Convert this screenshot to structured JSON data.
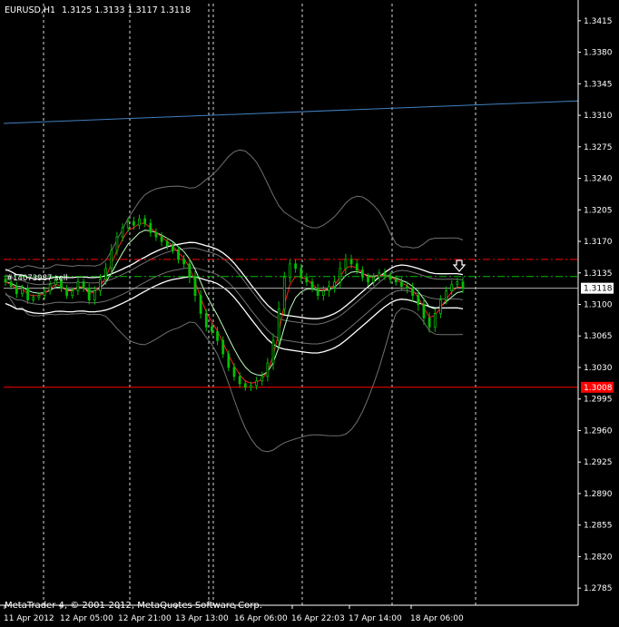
{
  "header": {
    "symbol": "EURUSD,H1",
    "ohlc": "1.3125 1.3133 1.3117 1.3118"
  },
  "order_label": "#14073987 sell",
  "footer": "MetaTrader 4, © 2001-2012, MetaQuotes Software Corp.",
  "colors": {
    "background": "#000000",
    "axis": "#ffffff",
    "candle": "#00c000",
    "fast_ma": "#ff2020",
    "slow_ma": "#c0ffc0",
    "envelope": "#ffffff",
    "bollinger": "#707070",
    "trend_line": "#4080c0",
    "order_line": "#00c000",
    "sl_line": "#ff0000",
    "support_line": "#ff0000",
    "bid_line": "#b0b0b0"
  },
  "chart_data": {
    "type": "candlestick",
    "timeframe": "H1",
    "ylim": [
      1.2766,
      1.3434
    ],
    "y_ticks": [
      "1.3415",
      "1.3380",
      "1.3345",
      "1.3310",
      "1.3275",
      "1.3240",
      "1.3205",
      "1.3170",
      "1.3135",
      "1.3100",
      "1.3065",
      "1.3030",
      "1.2995",
      "1.2960",
      "1.2925",
      "1.2890",
      "1.2855",
      "1.2820",
      "1.2785"
    ],
    "x_ticks": [
      "11 Apr 2012",
      "12 Apr 05:00",
      "12 Apr 21:00",
      "13 Apr 13:00",
      "16 Apr 06:00",
      "16 Apr 22:03",
      "17 Apr 14:00",
      "18 Apr 06:00"
    ],
    "price_labels": [
      {
        "name": "bid",
        "value": 1.3118,
        "text": "1.3118"
      },
      {
        "name": "support",
        "value": 1.3008,
        "text": "1.3008"
      }
    ],
    "horizontal_lines": [
      {
        "name": "support",
        "value": 1.3008,
        "style": "solid"
      },
      {
        "name": "stop",
        "value": 1.315,
        "style": "dash-dot"
      },
      {
        "name": "order",
        "value": 1.3131,
        "style": "dash-dot"
      },
      {
        "name": "bid",
        "value": 1.3118,
        "style": "solid"
      }
    ],
    "trend_line": {
      "from": 1.3301,
      "to": 1.3326
    },
    "candles_close": [
      1.3125,
      1.312,
      1.3112,
      1.3118,
      1.3105,
      1.3108,
      1.311,
      1.3115,
      1.3122,
      1.3128,
      1.3118,
      1.311,
      1.3115,
      1.3125,
      1.3118,
      1.3105,
      1.3115,
      1.3128,
      1.314,
      1.316,
      1.3175,
      1.3185,
      1.3192,
      1.3188,
      1.3195,
      1.319,
      1.318,
      1.3175,
      1.317,
      1.3165,
      1.316,
      1.315,
      1.3145,
      1.313,
      1.311,
      1.309,
      1.3075,
      1.307,
      1.306,
      1.3045,
      1.303,
      1.302,
      1.3012,
      1.3008,
      1.301,
      1.3015,
      1.302,
      1.3035,
      1.306,
      1.3095,
      1.313,
      1.3145,
      1.314,
      1.313,
      1.3125,
      1.3118,
      1.311,
      1.3115,
      1.312,
      1.3125,
      1.314,
      1.315,
      1.3145,
      1.3138,
      1.313,
      1.3125,
      1.313,
      1.3135,
      1.3132,
      1.3128,
      1.3125,
      1.312,
      1.3118,
      1.311,
      1.31,
      1.3085,
      1.3075,
      1.309,
      1.3105,
      1.3115,
      1.3122,
      1.3125,
      1.3118
    ],
    "candles_range": [
      0.0012,
      0.001,
      0.0014,
      0.0011,
      0.0012,
      0.0009,
      0.001,
      0.0013,
      0.0012,
      0.0014,
      0.0012,
      0.0011,
      0.001,
      0.0013,
      0.0012,
      0.0014,
      0.0015,
      0.0016,
      0.0018,
      0.002,
      0.0016,
      0.0014,
      0.0012,
      0.0015,
      0.0013,
      0.0012,
      0.0014,
      0.0013,
      0.0015,
      0.0012,
      0.0011,
      0.0013,
      0.0014,
      0.0018,
      0.002,
      0.0016,
      0.0014,
      0.0012,
      0.0015,
      0.0013,
      0.0012,
      0.0014,
      0.0013,
      0.0011,
      0.0012,
      0.0013,
      0.0015,
      0.0016,
      0.0022,
      0.0024,
      0.0018,
      0.0016,
      0.0014,
      0.0015,
      0.0013,
      0.0012,
      0.0014,
      0.0016,
      0.0018,
      0.002,
      0.0022,
      0.0018,
      0.0015,
      0.0013,
      0.0012,
      0.0014,
      0.0013,
      0.0012,
      0.0014,
      0.0013,
      0.0012,
      0.0014,
      0.0016,
      0.0018,
      0.002,
      0.0022,
      0.0018,
      0.0016,
      0.0015,
      0.0014,
      0.0013,
      0.0012,
      0.0015
    ]
  }
}
